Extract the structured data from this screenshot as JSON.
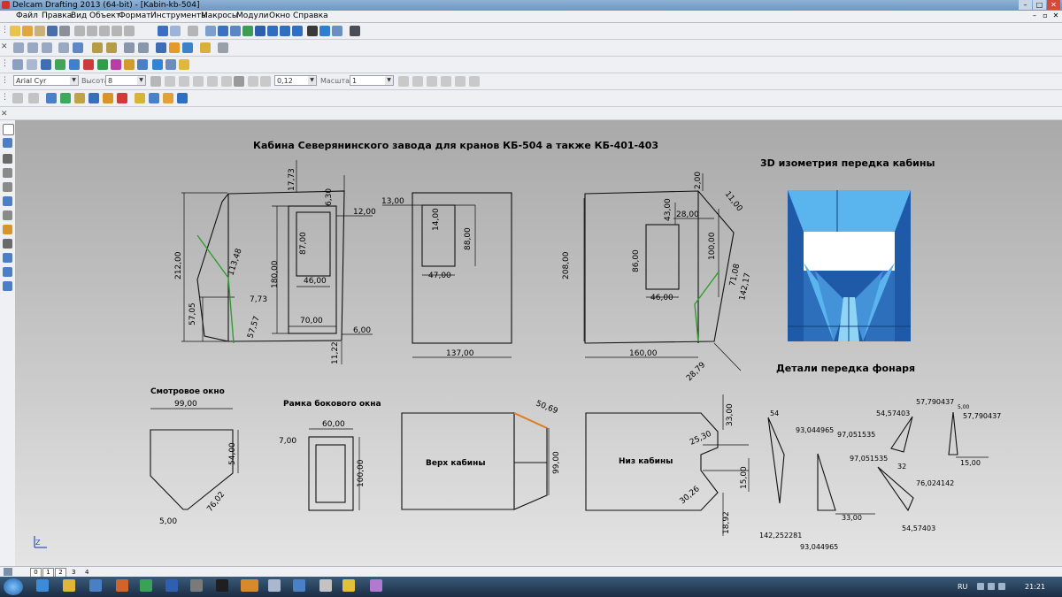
{
  "window": {
    "title": "Delcam Drafting 2013 (64-bit) - [Kabin-kb-504]",
    "minimize_icon": "minimize-icon",
    "maximize_icon": "maximize-icon",
    "close_icon": "close-icon"
  },
  "menu": {
    "items": [
      "Файл",
      "Правка",
      "Вид",
      "Объект",
      "Формат",
      "Инструменты",
      "Макросы",
      "Модули",
      "Окно",
      "Справка"
    ]
  },
  "font_toolbar": {
    "font": "Arial Cyr",
    "height_label": "Высота",
    "height_value": "8",
    "lineweight": "0,12",
    "scale_label": "Масштаб",
    "scale_value": "1"
  },
  "drawing": {
    "title": "Кабина Северянинского завода для кранов КБ-504 а также КБ-401-403",
    "iso_title": "3D изометрия передка кабины",
    "details_title": "Детали передка фонаря",
    "smotr_title": "Смотровое окно",
    "ramka_title": "Рамка бокового окна",
    "verh_label": "Верх кабины",
    "niz_label": "Низ кабины",
    "dims": {
      "side_17_73": "17,73",
      "side_6_30": "6,30",
      "side_12_00": "12,00",
      "side_212": "212,00",
      "side_113_48": "113,48",
      "side_180": "180,00",
      "side_87": "87,00",
      "side_46": "46,00",
      "side_57_05": "57,05",
      "side_7_73": "7,73",
      "side_57_57": "57,57",
      "side_70": "70,00",
      "side_6_00": "6,00",
      "side_11_22": "11,22",
      "front_13": "13,00",
      "front_14": "14,00",
      "front_88": "88,00",
      "front_47": "47,00",
      "front_137": "137,00",
      "right_2_00": "2,00",
      "right_11_00": "11,00",
      "right_43": "43,00",
      "right_28": "28,00",
      "right_208": "208,00",
      "right_86": "86,00",
      "right_100": "100,00",
      "right_71_08": "71,08",
      "right_142_17": "142,17",
      "right_46": "46,00",
      "right_160": "160,00",
      "right_28_79": "28,79",
      "sm_99": "99,00",
      "sm_54": "54,00",
      "sm_76_02": "76,02",
      "sm_5": "5,00",
      "rm_60": "60,00",
      "rm_7": "7,00",
      "rm_100": "100,00",
      "vh_50_69": "50,69",
      "vh_99": "99,00",
      "nz_33": "33,00",
      "nz_25_30": "25,30",
      "nz_15": "15,00",
      "nz_30_26": "30,26",
      "nz_18_92": "18,92",
      "d_54": "54",
      "d_142_25": "142,252281",
      "d_93_a": "93,044965",
      "d_93_b": "93,044965",
      "d_97_a": "97,051535",
      "d_97_b": "97,051535",
      "d_33": "33,00",
      "d_54_57_a": "54,57403",
      "d_54_57_b": "54,57403",
      "d_57_79_a": "57,790437",
      "d_57_79_b": "57,790437",
      "d_5_00": "5,00",
      "d_32": "32",
      "d_76_02": "76,024142",
      "d_15": "15,00"
    }
  },
  "sheets": {
    "tabs": [
      "0",
      "1",
      "2"
    ],
    "plain": [
      "3",
      "4"
    ]
  },
  "taskbar": {
    "lang": "RU",
    "time": "21:21"
  },
  "colors": {
    "canvas_top": "#a9a9a9",
    "canvas_bottom": "#e4e4e4",
    "iso_dark": "#1f5aa8",
    "iso_light": "#5ab4ee",
    "green_edge": "#2e9e2e",
    "orange_edge": "#e07a1a"
  }
}
